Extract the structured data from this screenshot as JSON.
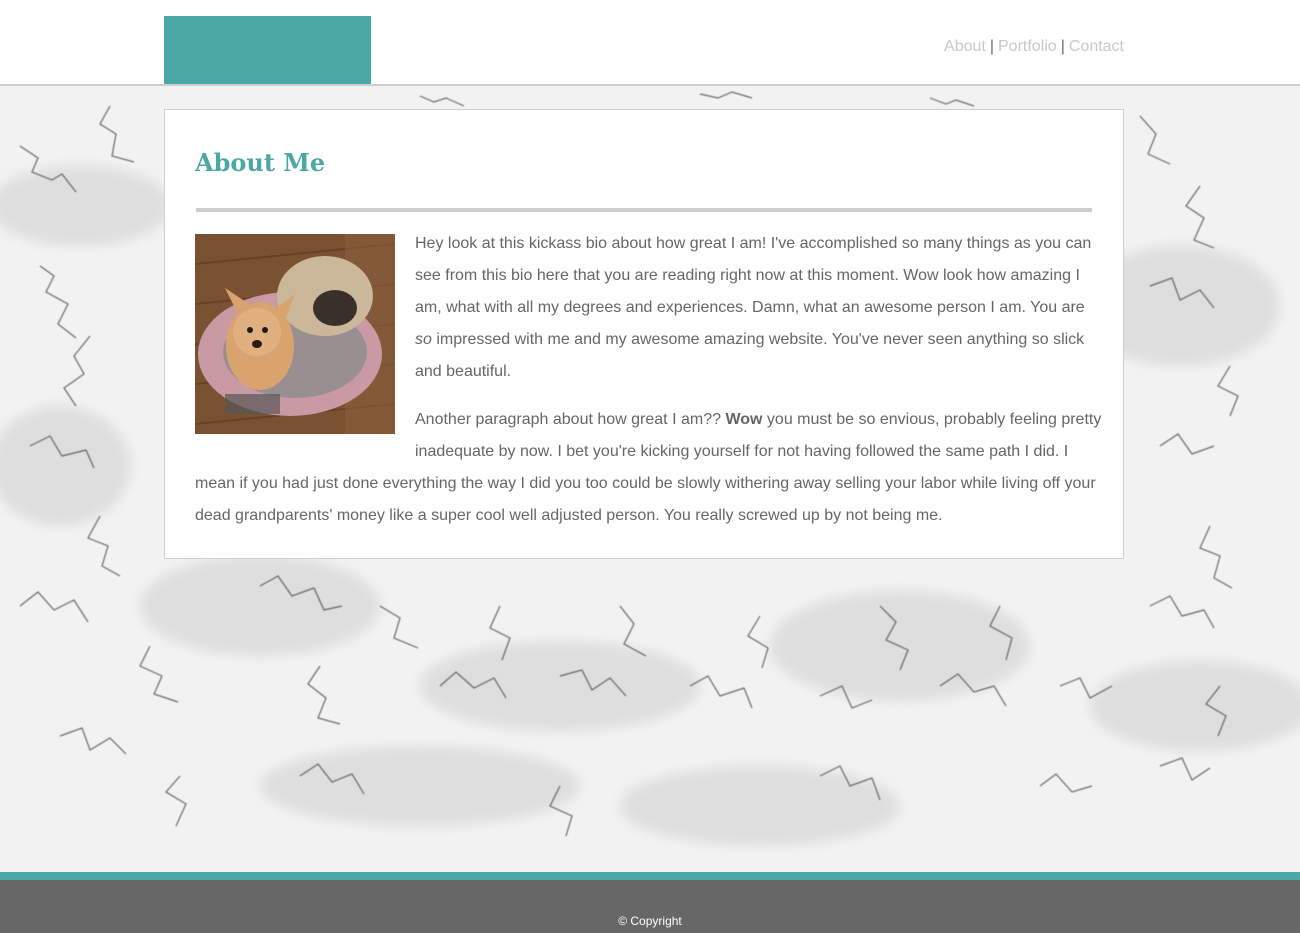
{
  "nav": {
    "about": "About",
    "portfolio": "Portfolio",
    "contact": "Contact",
    "separator": "|"
  },
  "content": {
    "title": "About Me",
    "photo_icon": "dogs-photo",
    "paragraph1_a": "Hey look at this kickass bio about how great I am! I've accomplished so many things as you can see from this bio here that you are reading right now at this moment. Wow look how amazing I am, what with all my degrees and experiences. Damn, what an awesome person I am. You are ",
    "paragraph1_em": "so",
    "paragraph1_b": " impressed with me and my awesome amazing website. You've never seen anything so slick and beautiful.",
    "paragraph2_a": "Another paragraph about how great I am?? ",
    "paragraph2_strong": "Wow",
    "paragraph2_b": " you must be so envious, probably feeling pretty inadequate by now. I bet you're kicking yourself for not having followed the same path I did. I mean if you had just done everything the way I did you too could be slowly withering away selling your labor while living off your dead grandparents' money like a super cool well adjusted person. You really screwed up by not being me."
  },
  "footer": {
    "copyright": "© Copyright"
  },
  "colors": {
    "accent": "#4aa8a5",
    "footer": "#676767",
    "text": "#666666",
    "nav_link": "#c8c8c8"
  }
}
